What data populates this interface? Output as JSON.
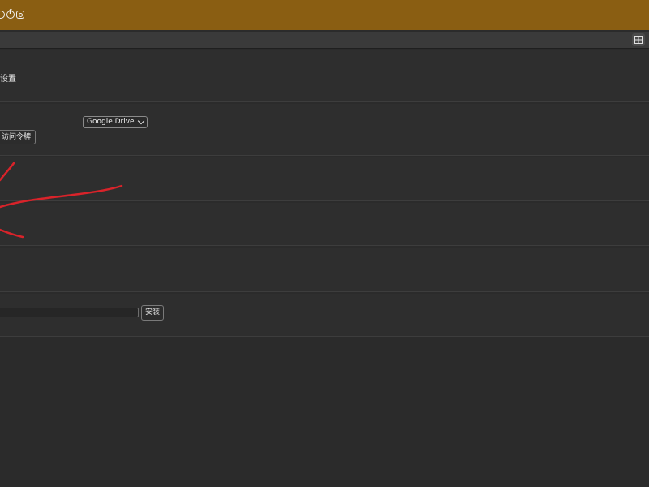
{
  "header": {
    "social_icons": [
      "github-icon",
      "facebook-icon",
      "instagram-icon"
    ]
  },
  "toolbar": {
    "grid_icon": "grid-icon"
  },
  "settings": {
    "section_title": "设置"
  },
  "sync": {
    "provider_selected": "Google Drive",
    "token_button_label": "访问令牌"
  },
  "install": {
    "input_value": "",
    "button_label": "安装"
  },
  "colors": {
    "header_bg": "#8a5e12",
    "page_bg": "#2b2b2b",
    "annotation_stroke": "#d9232a"
  }
}
